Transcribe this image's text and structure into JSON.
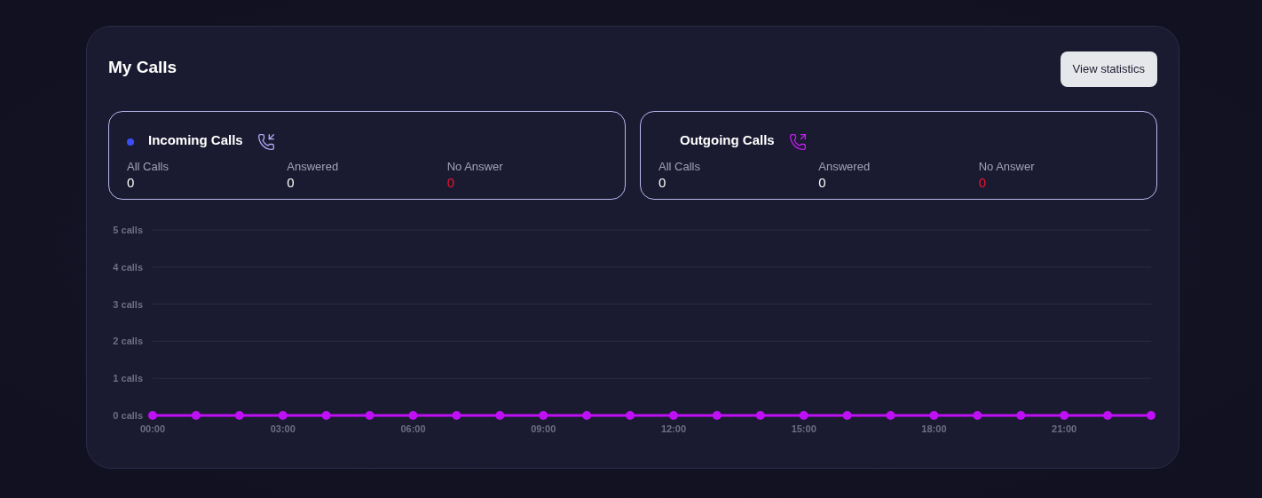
{
  "title": "My Calls",
  "button": "View statistics",
  "groups": [
    {
      "title": "Incoming Calls",
      "kind": "incoming",
      "color": "#3b4ef5",
      "stats": [
        {
          "label": "All Calls",
          "value": "0",
          "kind": "normal"
        },
        {
          "label": "Answered",
          "value": "0",
          "kind": "normal"
        },
        {
          "label": "No Answer",
          "value": "0",
          "kind": "alert"
        }
      ]
    },
    {
      "title": "Outgoing Calls",
      "kind": "outgoing",
      "stats": [
        {
          "label": "All Calls",
          "value": "0",
          "kind": "normal"
        },
        {
          "label": "Answered",
          "value": "0",
          "kind": "normal"
        },
        {
          "label": "No Answer",
          "value": "0",
          "kind": "alert"
        }
      ]
    }
  ],
  "chart_data": {
    "type": "line",
    "x": [
      0,
      1,
      2,
      3,
      4,
      5,
      6,
      7,
      8,
      9,
      10,
      11,
      12,
      13,
      14,
      15,
      16,
      17,
      18,
      19,
      20,
      21,
      22,
      23
    ],
    "grid": true,
    "series": [
      {
        "color": "#bf10f5",
        "marker": true,
        "values": [
          0,
          0,
          0,
          0,
          0,
          0,
          0,
          0,
          0,
          0,
          0,
          0,
          0,
          0,
          0,
          0,
          0,
          0,
          0,
          0,
          0,
          0,
          0,
          0
        ]
      }
    ],
    "xlim": [
      0,
      23
    ],
    "ylim": [
      0,
      5
    ],
    "xticks": [
      {
        "value": 0,
        "label": "00:00"
      },
      {
        "value": 3,
        "label": "03:00"
      },
      {
        "value": 6,
        "label": "06:00"
      },
      {
        "value": 9,
        "label": "09:00"
      },
      {
        "value": 12,
        "label": "12:00"
      },
      {
        "value": 15,
        "label": "15:00"
      },
      {
        "value": 18,
        "label": "18:00"
      },
      {
        "value": 21,
        "label": "21:00"
      }
    ],
    "yticks": [
      {
        "value": 0,
        "label": "0 calls"
      },
      {
        "value": 1,
        "label": "1 calls"
      },
      {
        "value": 2,
        "label": "2 calls"
      },
      {
        "value": 3,
        "label": "3 calls"
      },
      {
        "value": 4,
        "label": "4 calls"
      },
      {
        "value": 5,
        "label": "5 calls"
      }
    ]
  }
}
